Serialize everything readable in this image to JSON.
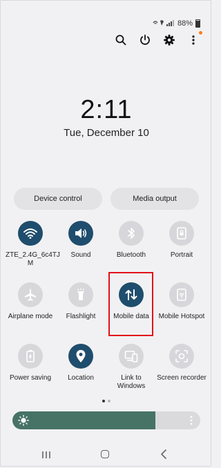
{
  "status_bar": {
    "battery_level": "88%"
  },
  "header": {
    "time": "2:11",
    "date": "Tue, December 10"
  },
  "actions": {
    "device_control": "Device control",
    "media_output": "Media output"
  },
  "tiles": [
    {
      "label": "ZTE_2.4G_6c4TJ M",
      "icon": "wifi-icon",
      "state": "on"
    },
    {
      "label": "Sound",
      "icon": "sound-icon",
      "state": "on"
    },
    {
      "label": "Bluetooth",
      "icon": "bluetooth-icon",
      "state": "off"
    },
    {
      "label": "Portrait",
      "icon": "portrait-lock-icon",
      "state": "off"
    },
    {
      "label": "Airplane mode",
      "icon": "airplane-icon",
      "state": "off"
    },
    {
      "label": "Flashlight",
      "icon": "flashlight-icon",
      "state": "off"
    },
    {
      "label": "Mobile data",
      "icon": "mobile-data-icon",
      "state": "on"
    },
    {
      "label": "Mobile Hotspot",
      "icon": "hotspot-icon",
      "state": "off"
    },
    {
      "label": "Power saving",
      "icon": "power-saving-icon",
      "state": "off"
    },
    {
      "label": "Location",
      "icon": "location-icon",
      "state": "on"
    },
    {
      "label": "Link to Windows",
      "icon": "link-to-windows-icon",
      "state": "off"
    },
    {
      "label": "Screen recorder",
      "icon": "screen-recorder-icon",
      "state": "off"
    }
  ],
  "page_indicator": {
    "current": 1,
    "total": 2
  },
  "brightness": {
    "level": 0.76
  },
  "colors": {
    "tile_on": "#1f4d6d",
    "tile_off": "#d7d7db",
    "brightness_fill": "#477366",
    "highlight": "#e2101a"
  }
}
